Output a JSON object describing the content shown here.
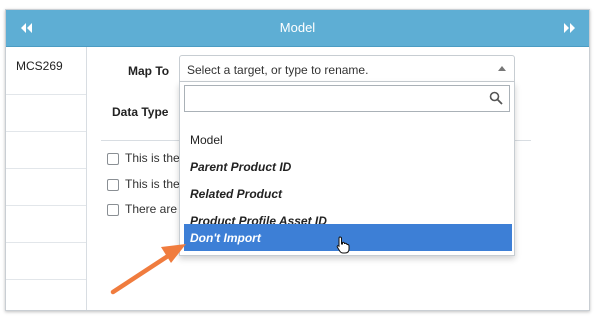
{
  "header": {
    "title": "Model",
    "prev_icon": "double-chevron-left-icon",
    "next_icon": "double-chevron-right-icon",
    "color": "#5eaed4"
  },
  "left_column": {
    "rows": [
      "MCS269",
      "",
      "",
      "",
      "",
      "",
      ""
    ]
  },
  "form": {
    "map_to_label": "Map To",
    "data_type_label": "Data Type",
    "select_placeholder": "Select a target, or type to rename."
  },
  "checkboxes": [
    {
      "label": "This is the",
      "checked": false
    },
    {
      "label": "This is the",
      "checked": false
    },
    {
      "label": "There are",
      "checked": false
    }
  ],
  "dropdown": {
    "search_value": "",
    "options": [
      {
        "label": "Model",
        "emphasis": false,
        "selected": false
      },
      {
        "label": "Parent Product ID",
        "emphasis": true,
        "selected": false
      },
      {
        "label": "Related Product",
        "emphasis": true,
        "selected": false
      },
      {
        "label": "Product Profile Asset ID",
        "emphasis": true,
        "selected": false
      },
      {
        "label": "Don't Import",
        "emphasis": true,
        "selected": true
      }
    ],
    "highlight_color": "#3d7fd6"
  },
  "annotation": {
    "type": "arrow",
    "color": "#f07c3e"
  },
  "cursor": "hand-pointer-icon"
}
